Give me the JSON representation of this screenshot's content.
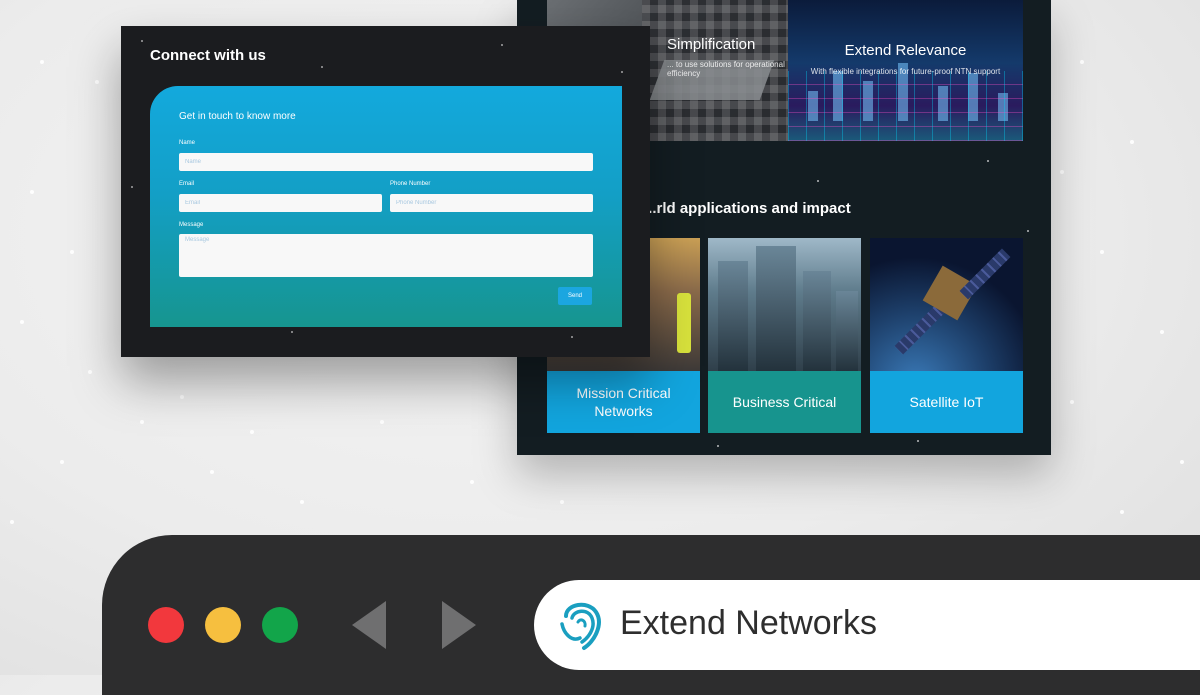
{
  "back_window": {
    "promo_left": {
      "title": "Simplification",
      "subtitle": "... to use solutions for operational efficiency"
    },
    "promo_right": {
      "title": "Extend Relevance",
      "subtitle": "With flexible integrations for future-proof NTN support"
    },
    "section_title": "...rld applications and impact",
    "cards": [
      {
        "label": "Mission Critical Networks"
      },
      {
        "label": "Business Critical"
      },
      {
        "label": "Satellite IoT"
      }
    ]
  },
  "form_window": {
    "title": "Connect with us",
    "heading": "Get in touch to know more",
    "fields": {
      "name": {
        "label": "Name",
        "placeholder": "Name"
      },
      "email": {
        "label": "Email",
        "placeholder": "Email"
      },
      "phone": {
        "label": "Phone Number",
        "placeholder": "Phone Number"
      },
      "message": {
        "label": "Message",
        "placeholder": "Message"
      }
    },
    "send_label": "Send"
  },
  "browser": {
    "site_name": "Extend Networks",
    "colors": {
      "close": "#f2383d",
      "minimize": "#f6bf3f",
      "maximize": "#12a54a",
      "brand": "#1a9fc0"
    },
    "icons": [
      "back-arrow-icon",
      "forward-arrow-icon",
      "extend-networks-logo-icon"
    ]
  }
}
